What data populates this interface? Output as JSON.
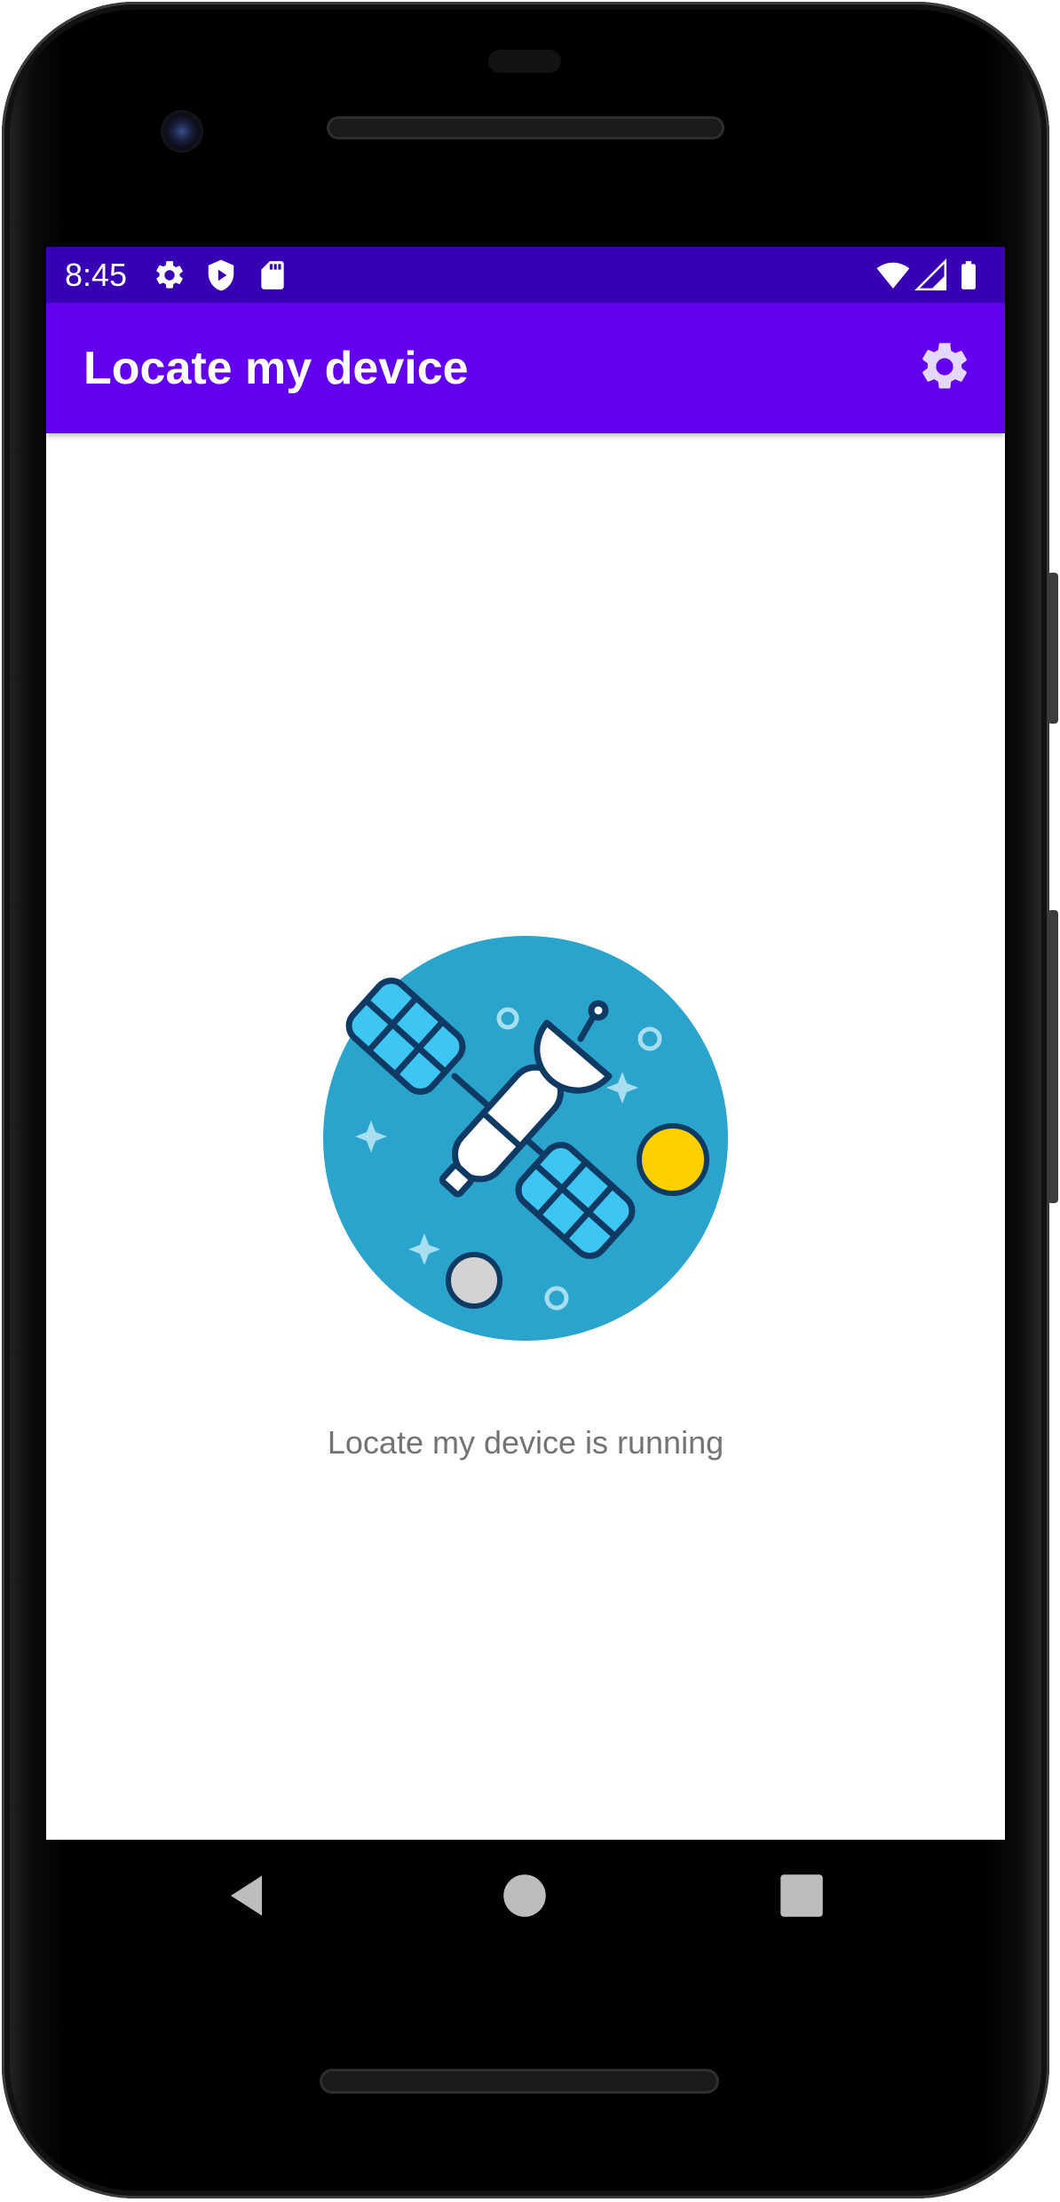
{
  "status_bar": {
    "time": "8:45",
    "icons": [
      "settings-icon",
      "shield-icon",
      "sd-card-icon",
      "wifi-icon",
      "signal-icon",
      "battery-icon"
    ]
  },
  "app_bar": {
    "title": "Locate my device",
    "settings_icon": "gear-icon"
  },
  "main": {
    "illustration": "satellite-icon",
    "status_message": "Locate my device is running"
  },
  "nav_bar": {
    "buttons": [
      "back-icon",
      "home-icon",
      "recents-icon"
    ]
  },
  "colors": {
    "status_bar": "#3700b3",
    "app_bar": "#6200ee",
    "settings_icon": "#e5d8ff",
    "illustration_bg": "#2aa4cc",
    "panel": "#3dc6f2",
    "outline": "#0f3a63",
    "sun": "#ffd000",
    "moon": "#d3d3d3",
    "message_text": "#737373"
  }
}
